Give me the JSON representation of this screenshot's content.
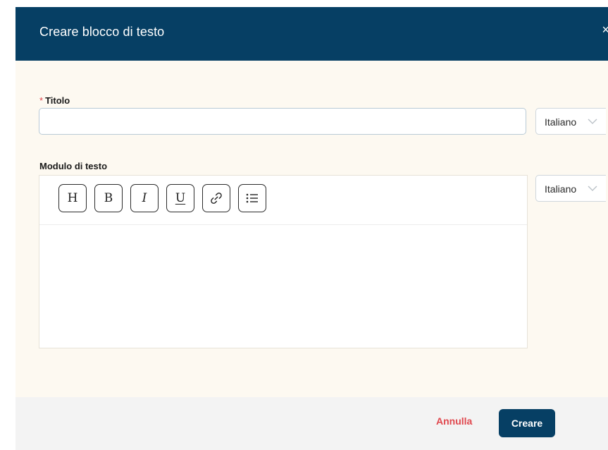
{
  "modal": {
    "title": "Creare blocco di testo",
    "close_icon": "close-icon",
    "close_glyph": "×"
  },
  "fields": {
    "title": {
      "required_mark": "*",
      "label": "Titolo",
      "value": "",
      "placeholder": "",
      "language": "Italiano"
    },
    "text_module": {
      "label": "Modulo di testo",
      "language": "Italiano",
      "toolbar": [
        {
          "name": "heading",
          "glyph": "H",
          "icon": "heading-icon"
        },
        {
          "name": "bold",
          "glyph": "B",
          "icon": "bold-icon"
        },
        {
          "name": "italic",
          "glyph": "I",
          "icon": "italic-icon"
        },
        {
          "name": "underline",
          "glyph": "U",
          "icon": "underline-icon"
        },
        {
          "name": "link",
          "glyph": "",
          "icon": "link-icon"
        },
        {
          "name": "list",
          "glyph": "",
          "icon": "bulleted-list-icon"
        }
      ],
      "content": ""
    }
  },
  "footer": {
    "cancel_label": "Annulla",
    "create_label": "Creare"
  },
  "colors": {
    "header_bg": "#063f64",
    "primary_button": "#063f64",
    "cancel_text": "#e0484e",
    "body_bg": "#fdf9f1",
    "footer_bg": "#f3f3f3"
  }
}
